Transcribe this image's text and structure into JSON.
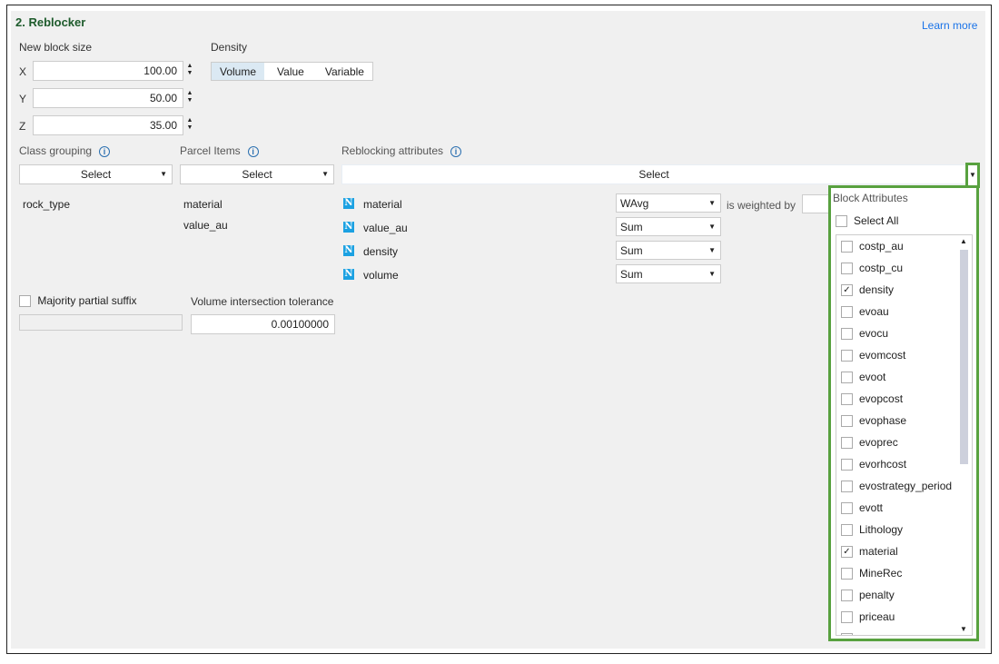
{
  "header": {
    "title": "2. Reblocker",
    "learn_more": "Learn more"
  },
  "block_size": {
    "label": "New block size",
    "x_label": "X",
    "x": "100.00",
    "y_label": "Y",
    "y": "50.00",
    "z_label": "Z",
    "z": "35.00"
  },
  "density": {
    "label": "Density",
    "options": [
      "Volume",
      "Value",
      "Variable"
    ],
    "selected": "Volume"
  },
  "class_grouping": {
    "label": "Class grouping",
    "select": "Select",
    "items": [
      "rock_type"
    ]
  },
  "parcel_items": {
    "label": "Parcel Items",
    "select": "Select",
    "items": [
      "material",
      "value_au"
    ]
  },
  "reblocking": {
    "label": "Reblocking attributes",
    "select": "Select",
    "weighted_by": "is weighted by",
    "attrs": [
      {
        "name": "material",
        "method": "WAvg"
      },
      {
        "name": "value_au",
        "method": "Sum"
      },
      {
        "name": "density",
        "method": "Sum"
      },
      {
        "name": "volume",
        "method": "Sum"
      }
    ]
  },
  "majority": {
    "label": "Majority partial suffix",
    "value": ""
  },
  "tolerance": {
    "label": "Volume intersection tolerance",
    "value": "0.00100000"
  },
  "popup": {
    "title": "Block Attributes",
    "select_all": "Select All",
    "items": [
      {
        "name": "costp_au",
        "checked": false
      },
      {
        "name": "costp_cu",
        "checked": false
      },
      {
        "name": "density",
        "checked": true
      },
      {
        "name": "evoau",
        "checked": false
      },
      {
        "name": "evocu",
        "checked": false
      },
      {
        "name": "evomcost",
        "checked": false
      },
      {
        "name": "evoot",
        "checked": false
      },
      {
        "name": "evopcost",
        "checked": false
      },
      {
        "name": "evophase",
        "checked": false
      },
      {
        "name": "evoprec",
        "checked": false
      },
      {
        "name": "evorhcost",
        "checked": false
      },
      {
        "name": "evostrategy_period",
        "checked": false
      },
      {
        "name": "evott",
        "checked": false
      },
      {
        "name": "Lithology",
        "checked": false
      },
      {
        "name": "material",
        "checked": true
      },
      {
        "name": "MineRec",
        "checked": false
      },
      {
        "name": "penalty",
        "checked": false
      },
      {
        "name": "priceau",
        "checked": false
      }
    ]
  },
  "colors": {
    "accent": "#58a13f",
    "title": "#1e5b2c",
    "link": "#1a73e8"
  }
}
